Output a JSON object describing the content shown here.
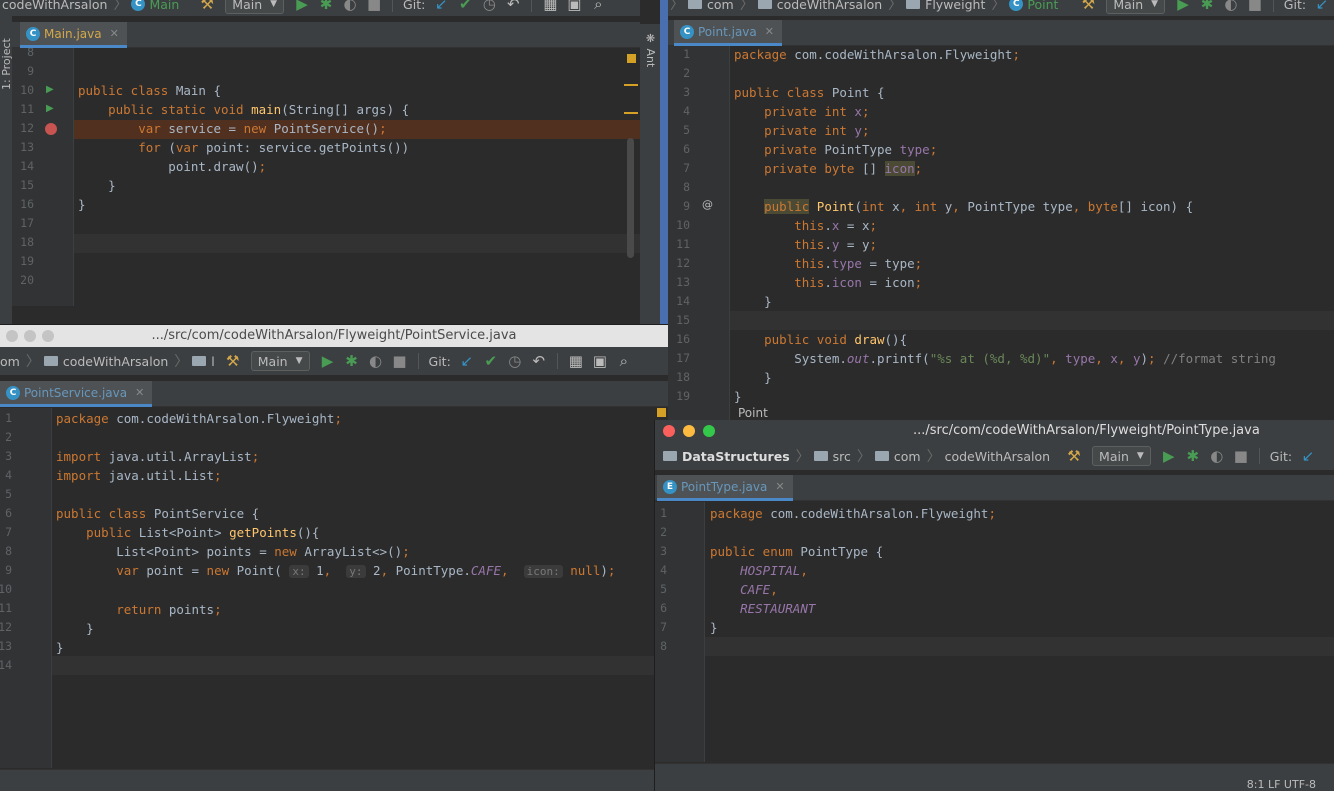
{
  "main_window": {
    "nav": {
      "project": "codeWithArsalon",
      "file": "Main"
    },
    "toolbar": {
      "config": "Main",
      "git_label": "Git:"
    },
    "sidebar": {
      "project_label": "1: Project",
      "ant_label": "Ant"
    },
    "tab": {
      "label": "Main.java"
    },
    "line_numbers": [
      "8",
      "9",
      "10",
      "11",
      "12",
      "13",
      "14",
      "15",
      "16",
      "17",
      "18",
      "19",
      "20"
    ]
  },
  "point_window": {
    "nav": {
      "items": [
        "com",
        "codeWithArsalon",
        "Flyweight",
        "Point"
      ]
    },
    "toolbar": {
      "config": "Main",
      "git_label": "Git:"
    },
    "tab": {
      "label": "Point.java"
    },
    "line_numbers": [
      "1",
      "2",
      "3",
      "4",
      "5",
      "6",
      "7",
      "8",
      "9",
      "10",
      "11",
      "12",
      "13",
      "14",
      "15",
      "16",
      "17",
      "18",
      "19"
    ],
    "footer_hint": "Point"
  },
  "service_window": {
    "title": ".../src/com/codeWithArsalon/Flyweight/PointService.java",
    "nav": {
      "items": [
        "om",
        "codeWithArsalon",
        "l"
      ]
    },
    "toolbar": {
      "config": "Main",
      "git_label": "Git:"
    },
    "tab": {
      "label": "PointService.java"
    },
    "line_numbers": [
      "1",
      "2",
      "3",
      "4",
      "5",
      "6",
      "7",
      "8",
      "9",
      "10",
      "11",
      "12",
      "13",
      "14"
    ]
  },
  "type_window": {
    "title": ".../src/com/codeWithArsalon/Flyweight/PointType.java",
    "nav": {
      "items": [
        "DataStructures",
        "src",
        "com",
        "codeWithArsalon"
      ]
    },
    "toolbar": {
      "config": "Main",
      "git_label": "Git:"
    },
    "tab": {
      "label": "PointType.java"
    },
    "line_numbers": [
      "1",
      "2",
      "3",
      "4",
      "5",
      "6",
      "7",
      "8"
    ],
    "status": "8:1  LF  UTF-8"
  },
  "colors": {
    "keyword": "#cc7832",
    "method": "#ffc66d",
    "field": "#9876aa",
    "string": "#6a8759",
    "comment": "#808080",
    "background": "#2b2b2b"
  }
}
